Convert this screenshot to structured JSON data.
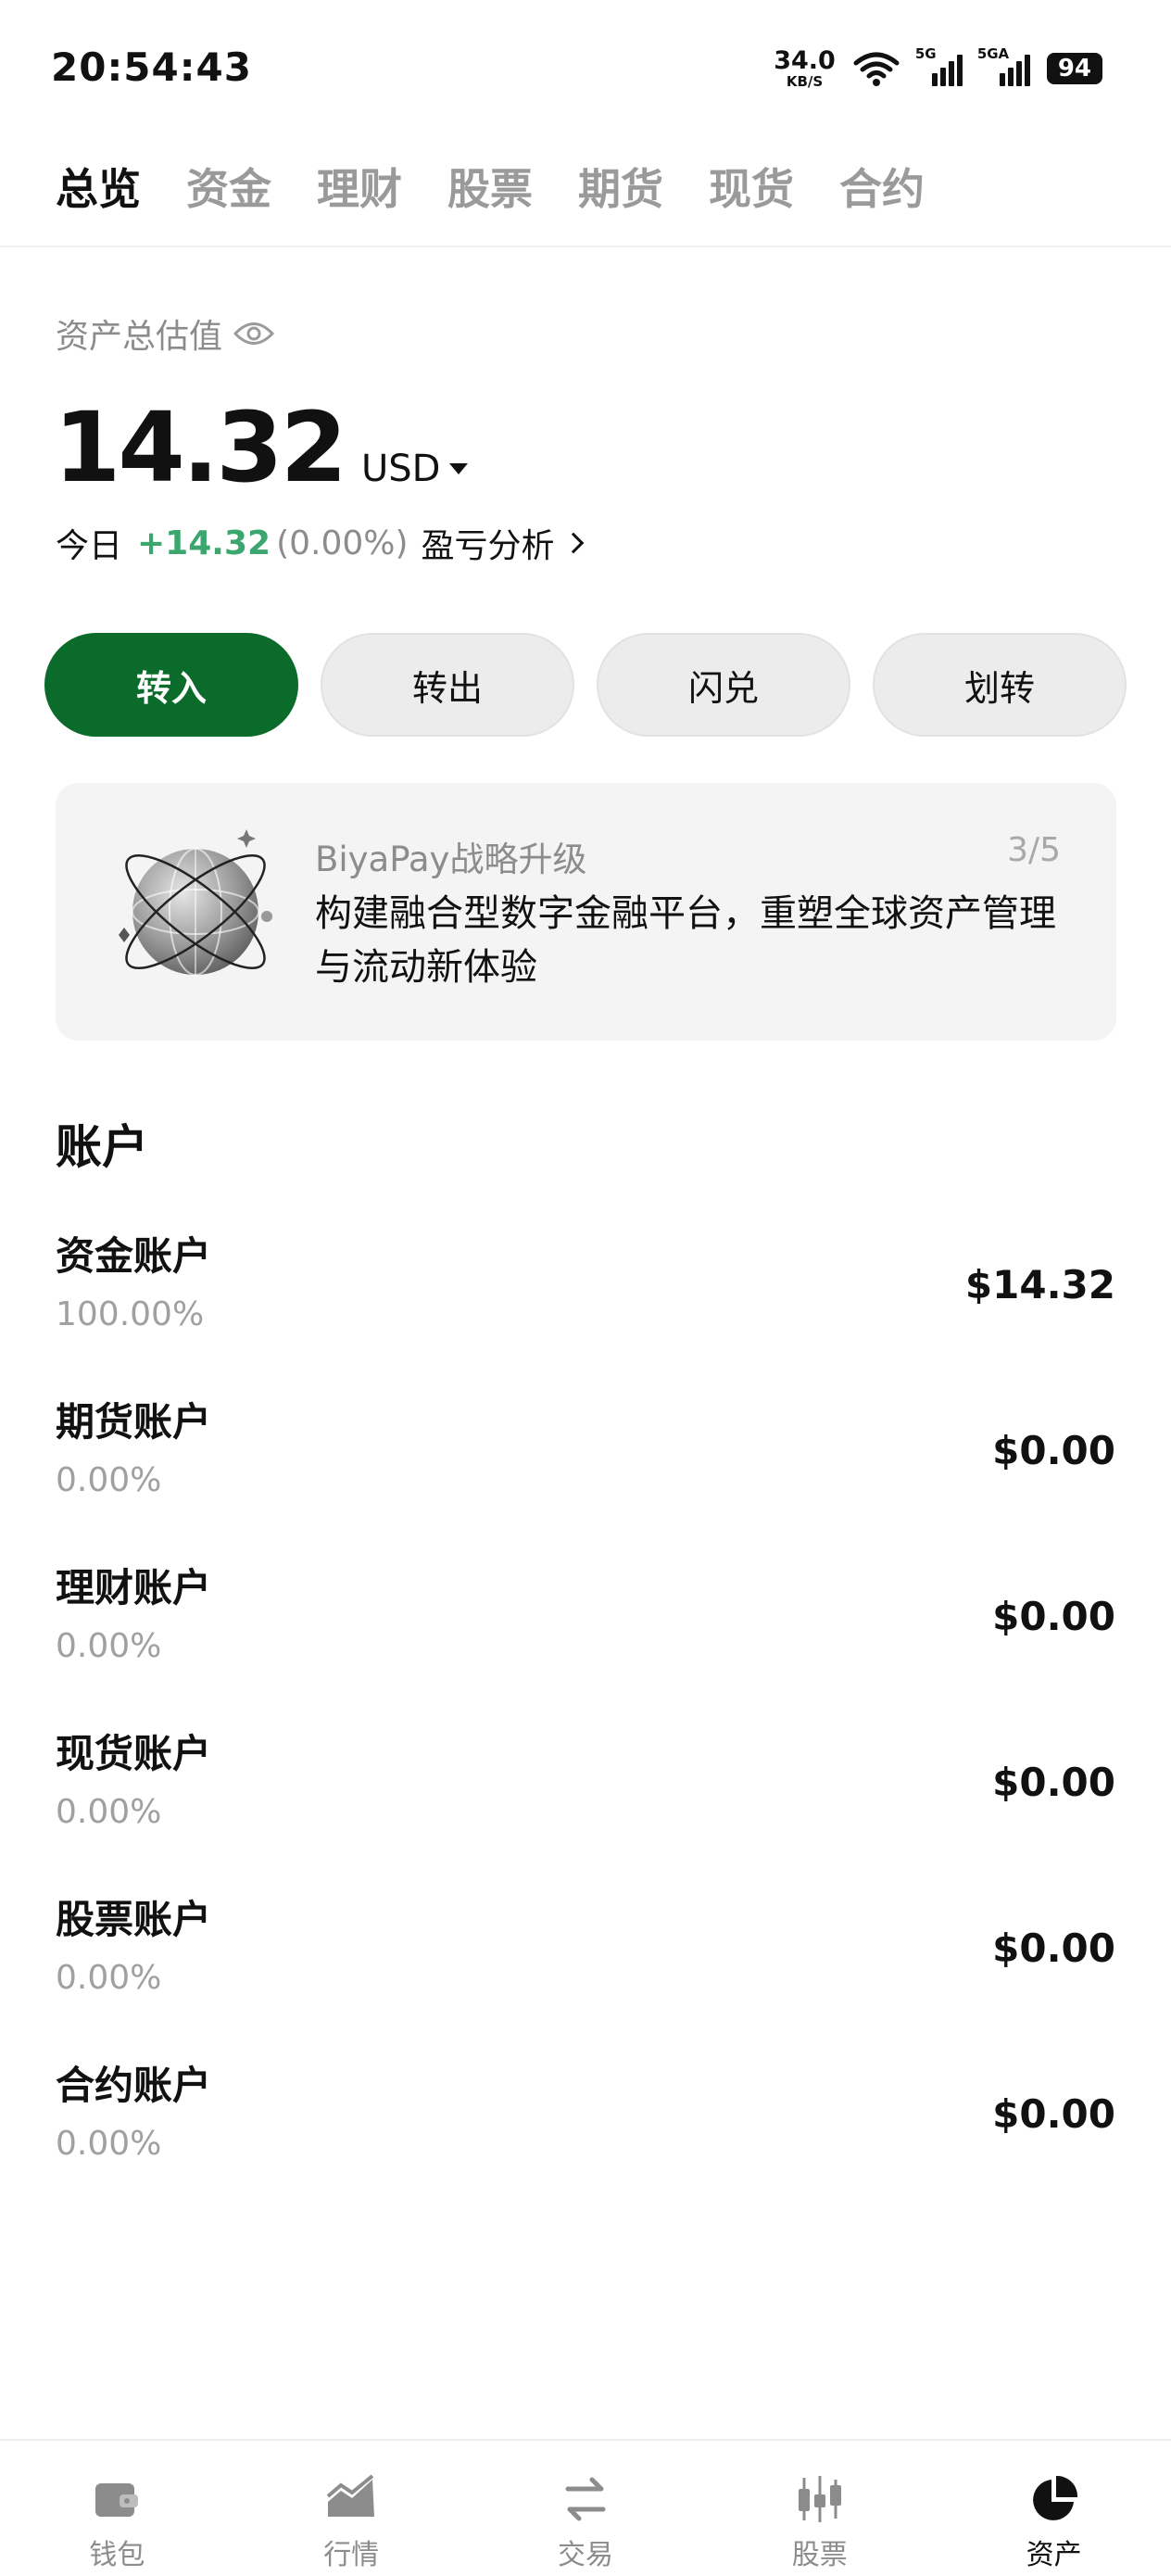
{
  "status_bar": {
    "time": "20:54:43",
    "net_speed_value": "34.0",
    "net_speed_unit": "KB/S",
    "signal_1": "5G",
    "signal_2": "5GA",
    "battery": "94"
  },
  "tabs": [
    "总览",
    "资金",
    "理财",
    "股票",
    "期货",
    "现货",
    "合约"
  ],
  "summary": {
    "label": "资产总估值",
    "amount": "14.32",
    "currency": "USD",
    "today_label": "今日",
    "today_pnl": "+14.32",
    "today_pct": "(0.00%)",
    "analysis_link": "盈亏分析"
  },
  "actions": [
    "转入",
    "转出",
    "闪兑",
    "划转"
  ],
  "banner": {
    "title": "BiyaPay战略升级",
    "page": "3/5",
    "text": "构建融合型数字金融平台，重塑全球资产管理与流动新体验"
  },
  "accounts": {
    "title": "账户",
    "items": [
      {
        "name": "资金账户",
        "pct": "100.00%",
        "amount": "$14.32"
      },
      {
        "name": "期货账户",
        "pct": "0.00%",
        "amount": "$0.00"
      },
      {
        "name": "理财账户",
        "pct": "0.00%",
        "amount": "$0.00"
      },
      {
        "name": "现货账户",
        "pct": "0.00%",
        "amount": "$0.00"
      },
      {
        "name": "股票账户",
        "pct": "0.00%",
        "amount": "$0.00"
      },
      {
        "name": "合约账户",
        "pct": "0.00%",
        "amount": "$0.00"
      }
    ]
  },
  "bottom_nav": [
    {
      "label": "钱包",
      "icon": "wallet-icon"
    },
    {
      "label": "行情",
      "icon": "market-chart-icon"
    },
    {
      "label": "交易",
      "icon": "swap-arrows-icon"
    },
    {
      "label": "股票",
      "icon": "candlestick-icon"
    },
    {
      "label": "资产",
      "icon": "pie-chart-icon"
    }
  ],
  "colors": {
    "accent_green": "#0b6b2a",
    "profit_green": "#3ca66f"
  }
}
